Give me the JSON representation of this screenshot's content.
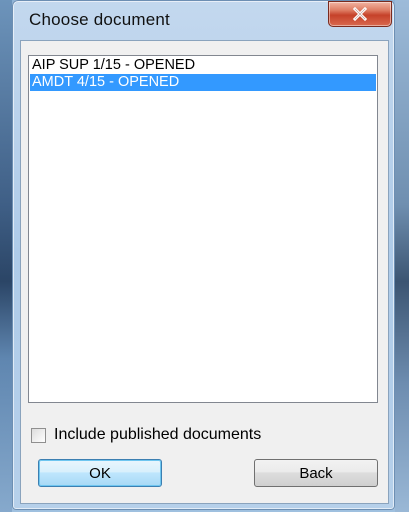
{
  "window": {
    "title": "Choose document"
  },
  "list": {
    "items": [
      {
        "label": "AIP SUP 1/15 - OPENED",
        "selected": false
      },
      {
        "label": "AMDT 4/15 - OPENED",
        "selected": true
      }
    ]
  },
  "checkbox": {
    "label": "Include published documents",
    "checked": false
  },
  "buttons": {
    "ok_label": "OK",
    "back_label": "Back"
  },
  "colors": {
    "selection": "#3399ff",
    "close_button": "#c6422a",
    "default_button_border": "#3c7fb1"
  },
  "icons": {
    "close": "close-x-icon"
  }
}
